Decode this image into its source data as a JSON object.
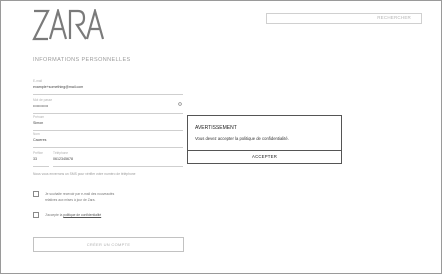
{
  "brand": {
    "logo_text": "ZARA"
  },
  "search": {
    "placeholder": "RECHERCHER"
  },
  "section_title": "INFORMATIONS PERSONNELLES",
  "fields": {
    "email": {
      "label": "E-mail",
      "value": "example+something@mail.com"
    },
    "password": {
      "label": "Mot de passe",
      "value": "••••••••••••"
    },
    "first_name": {
      "label": "Prénom",
      "value": "Simon"
    },
    "last_name": {
      "label": "Nom",
      "value": "Caceres"
    },
    "phone_prefix": {
      "label": "Préfixe",
      "value": "33"
    },
    "phone_number": {
      "label": "Téléphone",
      "value": "0612345678"
    }
  },
  "helper_text": "Nous vous enverrons un SMS pour vérifier votre numéro de téléphone",
  "checkboxes": {
    "newsletter_line1": "Je souhaite recevoir par e-mail des nouveautés",
    "newsletter_line2": "relatives aux mises à jour de Zara.",
    "privacy_prefix": "J'accepte la",
    "privacy_link": "politique de confidentialité"
  },
  "create_account_label": "CRÉER UN COMPTE",
  "modal": {
    "title": "AVERTISSEMENT",
    "message": "Vous devez accepter la politique de confidentialité.",
    "button_label": "ACCEPTER"
  }
}
